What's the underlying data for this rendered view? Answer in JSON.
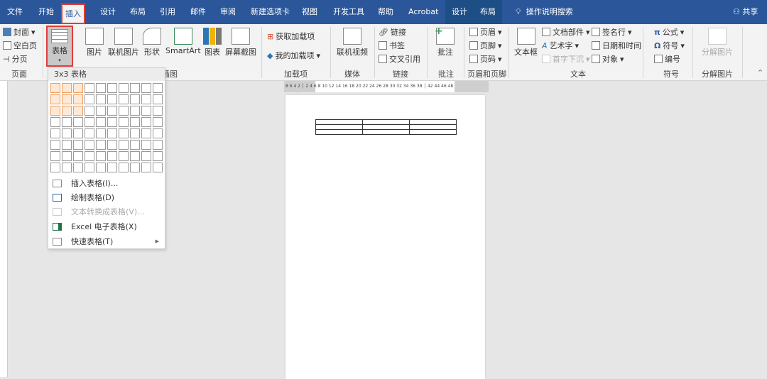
{
  "tabs": [
    "文件",
    "开始",
    "插入",
    "设计",
    "布局",
    "引用",
    "邮件",
    "审阅",
    "新建选项卡",
    "视图",
    "开发工具",
    "帮助",
    "Acrobat",
    "设计",
    "布局"
  ],
  "search": "操作说明搜索",
  "share": "共享",
  "ribbon": {
    "page": {
      "cover": "封面",
      "blank": "空白页",
      "break": "分页",
      "label": "页面"
    },
    "table": "表格",
    "illustrations": {
      "picture": "图片",
      "online_picture": "联机图片",
      "shapes": "形状",
      "smartart": "SmartArt",
      "chart": "图表",
      "screenshot": "屏幕截图",
      "label": "插图"
    },
    "addins": {
      "get": "获取加载项",
      "my": "我的加载项",
      "label": "加载项"
    },
    "media": {
      "video": "联机视频",
      "label": "媒体"
    },
    "links": {
      "link": "链接",
      "bookmark": "书签",
      "crossref": "交叉引用",
      "label": "链接"
    },
    "comments": {
      "comment": "批注",
      "label": "批注"
    },
    "header_footer": {
      "header": "页眉",
      "footer": "页脚",
      "page_number": "页码",
      "label": "页眉和页脚"
    },
    "text": {
      "textbox": "文本框",
      "quick_parts": "文档部件",
      "wordart": "艺术字",
      "dropcap": "首字下沉",
      "signature": "签名行",
      "datetime": "日期和时间",
      "object": "对象",
      "label": "文本"
    },
    "symbols": {
      "equation": "公式",
      "symbol": "符号",
      "number": "编号",
      "label": "符号"
    },
    "decompose": {
      "button": "分解图片",
      "label": "分解图片"
    }
  },
  "ruler": "8 6 4 2 │ 2 4 6 8 10 12 14 16 18 20 22 24 26 28 30 32 34 36 38 │ 42 44 46 48",
  "table_menu": {
    "header": "3x3 表格",
    "grid": {
      "cols": 10,
      "rows": 8,
      "selected_cols": 3,
      "selected_rows": 3
    },
    "items": [
      {
        "label": "插入表格(I)...",
        "enabled": true
      },
      {
        "label": "绘制表格(D)",
        "enabled": true
      },
      {
        "label": "文本转换成表格(V)...",
        "enabled": false
      },
      {
        "label": "Excel 电子表格(X)",
        "enabled": true
      },
      {
        "label": "快速表格(T)",
        "enabled": true,
        "submenu": true
      }
    ]
  },
  "document": {
    "table_rows": 3,
    "table_cols": 3
  }
}
